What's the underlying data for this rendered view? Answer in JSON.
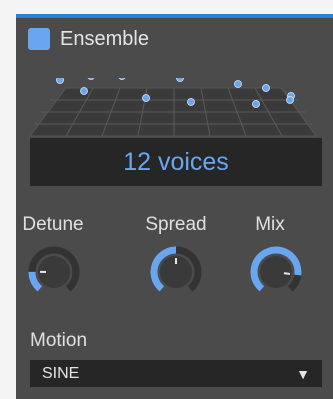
{
  "panel": {
    "title": "Ensemble",
    "enabled": true,
    "accent": "#6aa6f0",
    "border_accent": "#2a7fd6"
  },
  "voices": {
    "readout": "12 voices",
    "count": 12
  },
  "knobs": [
    {
      "label": "Detune",
      "value": 0.18
    },
    {
      "label": "Spread",
      "value": 0.5
    },
    {
      "label": "Mix",
      "value": 0.85
    }
  ],
  "motion": {
    "label": "Motion",
    "selected": "SINE",
    "icon": "dropdown-arrow-icon"
  }
}
